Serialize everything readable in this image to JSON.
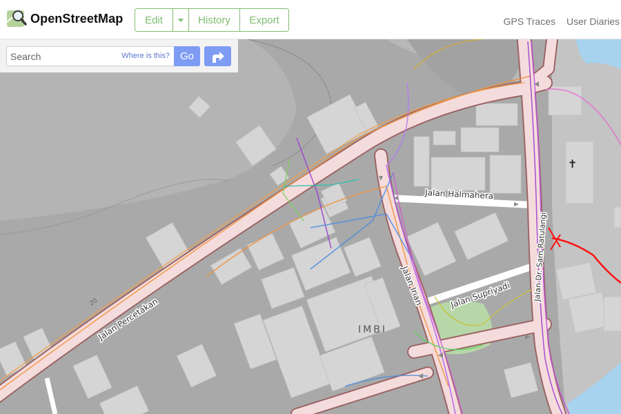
{
  "header": {
    "brand": "OpenStreetMap",
    "nav": {
      "edit": "Edit",
      "history": "History",
      "export": "Export"
    },
    "right_links": [
      "GPS Traces",
      "User Diaries"
    ]
  },
  "search": {
    "placeholder": "Search",
    "where_link": "Where is this?",
    "go_label": "Go"
  },
  "map": {
    "street_labels": {
      "percetakan": "Jalan Percetakan",
      "halmahera": "Jalan Halmahera",
      "irian": "Jalan Irian",
      "supriyadi": "Jalan Supriyadi",
      "ratulangi": "Jalan Dr. Sam Ratulangi"
    },
    "area_label": "IMBI",
    "road_number": "20",
    "church_symbol": "✝"
  },
  "colors": {
    "brand_green": "#7ebc6f",
    "button_blue": "#7e9cf4",
    "land": "#a9a9a9",
    "building": "#d5d5d5",
    "road_casing": "#9b6565",
    "road_fill": "#f5dcdc",
    "water": "#a7d3ef",
    "park": "#b7d7a8",
    "boundary": "#ff1010"
  }
}
